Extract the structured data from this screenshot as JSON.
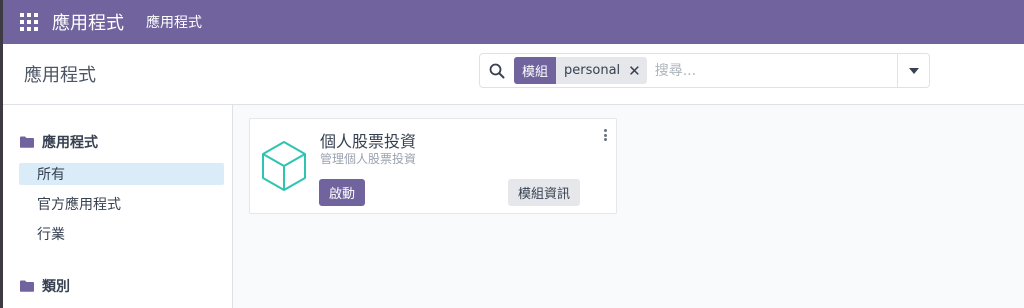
{
  "navbar": {
    "apps_icon": "grid-icon",
    "brand": "應用程式",
    "menu_item": "應用程式",
    "color": "#71639e"
  },
  "control_panel": {
    "breadcrumb": "應用程式",
    "search": {
      "facet_label": "模組",
      "facet_value": "personal",
      "placeholder": "搜尋..."
    }
  },
  "sidebar": {
    "sections": [
      {
        "title": "應用程式",
        "icon": "folder-icon",
        "items": [
          {
            "label": "所有",
            "active": true
          },
          {
            "label": "官方應用程式",
            "active": false
          },
          {
            "label": "行業",
            "active": false
          }
        ]
      },
      {
        "title": "類別",
        "icon": "folder-icon",
        "items": []
      }
    ]
  },
  "apps": [
    {
      "name": "個人股票投資",
      "summary": "管理個人股票投資",
      "icon": "cube-icon",
      "activate_label": "啟動",
      "info_label": "模組資訊"
    }
  ]
}
